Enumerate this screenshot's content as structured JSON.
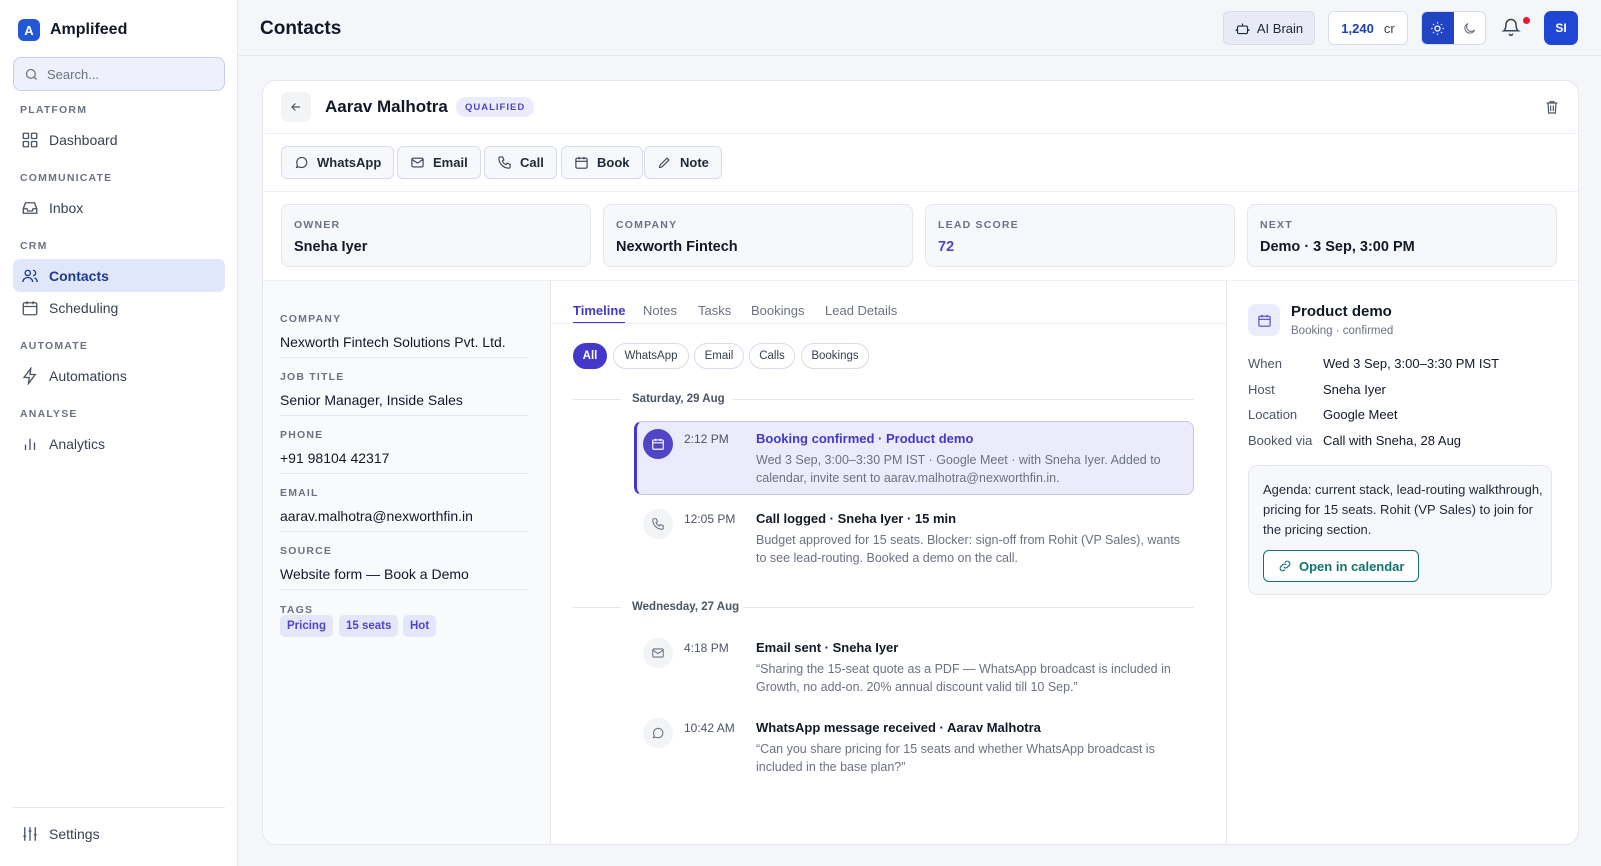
{
  "app": {
    "name": "Amplifeed",
    "logo_letter": "A"
  },
  "search": {
    "placeholder": "Search..."
  },
  "sidebar": {
    "sections": [
      "PLATFORM",
      "COMMUNICATE",
      "CRM",
      "AUTOMATE",
      "ANALYSE"
    ],
    "items": [
      {
        "label": "Dashboard",
        "icon": "grid-icon"
      },
      {
        "label": "Inbox",
        "icon": "inbox-icon"
      },
      {
        "label": "Contacts",
        "icon": "users-icon",
        "active": true
      },
      {
        "label": "Scheduling",
        "icon": "calendar-icon"
      },
      {
        "label": "Automations",
        "icon": "bolt-icon"
      },
      {
        "label": "Analytics",
        "icon": "bar-chart-icon"
      }
    ],
    "settings_label": "Settings"
  },
  "topbar": {
    "title": "Contacts",
    "ai_brain_label": "AI Brain",
    "credits_value": "1,240",
    "credits_unit": "cr",
    "avatar_initials": "SI"
  },
  "contact": {
    "name": "Aarav Malhotra",
    "status": "QUALIFIED",
    "actions": [
      "WhatsApp",
      "Email",
      "Call",
      "Book",
      "Note"
    ],
    "stats": [
      {
        "label": "OWNER",
        "value": "Sneha Iyer"
      },
      {
        "label": "COMPANY",
        "value": "Nexworth Fintech"
      },
      {
        "label": "LEAD SCORE",
        "value": "72"
      },
      {
        "label": "NEXT",
        "value": "Demo · 3 Sep, 3:00 PM"
      }
    ],
    "fields": [
      {
        "label": "COMPANY",
        "value": "Nexworth Fintech Solutions Pvt. Ltd."
      },
      {
        "label": "JOB TITLE",
        "value": "Senior Manager, Inside Sales"
      },
      {
        "label": "PHONE",
        "value": "+91 98104 42317"
      },
      {
        "label": "EMAIL",
        "value": "aarav.malhotra@nexworthfin.in"
      },
      {
        "label": "SOURCE",
        "value": "Website form — Book a Demo"
      }
    ],
    "tags_label": "TAGS",
    "tags": [
      "Pricing",
      "15 seats",
      "Hot"
    ]
  },
  "timeline": {
    "tabs": [
      "Timeline",
      "Notes",
      "Tasks",
      "Bookings",
      "Lead Details"
    ],
    "filters": [
      "All",
      "WhatsApp",
      "Email",
      "Calls",
      "Bookings"
    ],
    "days": [
      "Saturday, 29 Aug",
      "Wednesday, 27 Aug"
    ],
    "events": [
      {
        "time": "2:12 PM",
        "title": "Booking confirmed · Product demo",
        "body": "Wed 3 Sep, 3:00–3:30 PM IST · Google Meet · with Sneha Iyer. Added to calendar, invite sent to aarav.malhotra@nexworthfin.in.",
        "icon": "calendar-icon"
      },
      {
        "time": "12:05 PM",
        "title": "Call logged · Sneha Iyer · 15 min",
        "body": "Budget approved for 15 seats. Blocker: sign-off from Rohit (VP Sales), wants to see lead-routing. Booked a demo on the call.",
        "icon": "phone-icon"
      },
      {
        "time": "4:18 PM",
        "title": "Email sent · Sneha Iyer",
        "body": "“Sharing the 15-seat quote as a PDF — WhatsApp broadcast is included in Growth, no add-on. 20% annual discount valid till 10 Sep.”",
        "icon": "mail-icon"
      },
      {
        "time": "10:42 AM",
        "title": "WhatsApp message received · Aarav Malhotra",
        "body": "“Can you share pricing for 15 seats and whether WhatsApp broadcast is included in the base plan?”",
        "icon": "chat-icon"
      }
    ]
  },
  "booking": {
    "title": "Product demo",
    "subtitle": "Booking · confirmed",
    "details": [
      {
        "key": "When",
        "value": "Wed 3 Sep, 3:00–3:30 PM IST"
      },
      {
        "key": "Host",
        "value": "Sneha Iyer"
      },
      {
        "key": "Location",
        "value": "Google Meet"
      },
      {
        "key": "Booked via",
        "value": "Call with Sneha, 28 Aug"
      }
    ],
    "agenda": "Agenda: current stack, lead-routing walkthrough, pricing for 15 seats. Rohit (VP Sales) to join for the pricing section.",
    "calendar_button": "Open in calendar"
  },
  "colors": {
    "accent": "#4338ca",
    "brand": "#2457d6",
    "teal": "#0f766e",
    "notify": "#e11d2e"
  }
}
